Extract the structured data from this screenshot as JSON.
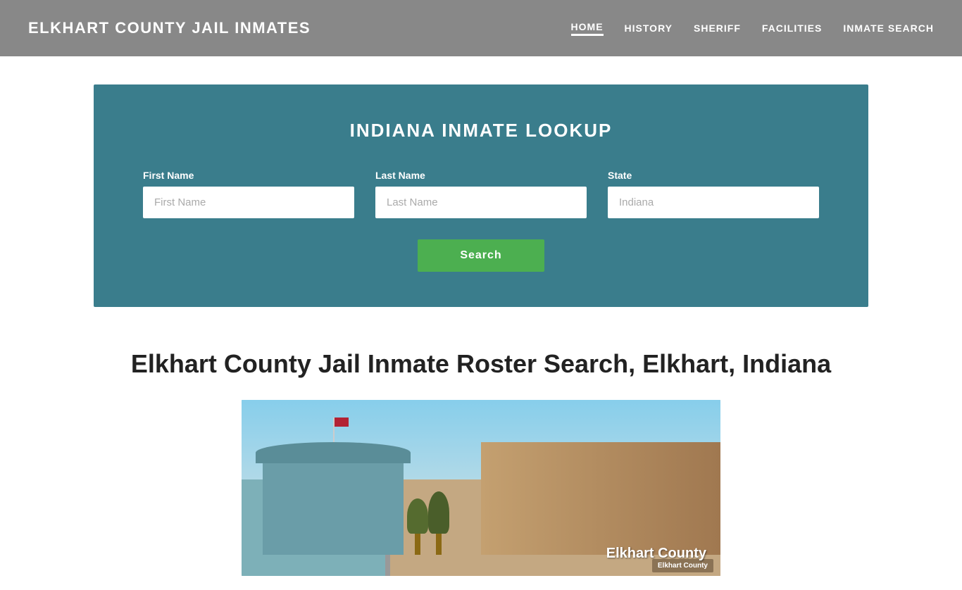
{
  "header": {
    "site_title": "ELKHART COUNTY JAIL INMATES",
    "nav": {
      "items": [
        {
          "label": "HOME",
          "href": "#",
          "active": true
        },
        {
          "label": "HISTORY",
          "href": "#",
          "active": false
        },
        {
          "label": "SHERIFF",
          "href": "#",
          "active": false
        },
        {
          "label": "FACILITIES",
          "href": "#",
          "active": false
        },
        {
          "label": "INMATE SEARCH",
          "href": "#",
          "active": false
        }
      ]
    }
  },
  "search_section": {
    "title": "INDIANA INMATE LOOKUP",
    "first_name_label": "First Name",
    "first_name_placeholder": "First Name",
    "last_name_label": "Last Name",
    "last_name_placeholder": "Last Name",
    "state_label": "State",
    "state_value": "Indiana",
    "search_button_label": "Search"
  },
  "main": {
    "heading": "Elkhart County Jail Inmate Roster Search, Elkhart, Indiana",
    "sign_text": "Elkhart County"
  },
  "colors": {
    "header_bg": "#888888",
    "search_bg": "#3a7d8c",
    "search_btn": "#4caf50",
    "nav_text": "#ffffff",
    "title_text": "#ffffff"
  }
}
